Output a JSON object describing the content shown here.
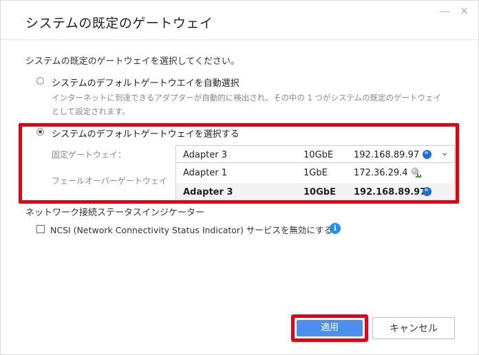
{
  "dialog": {
    "title": "システムの既定のゲートウェイ",
    "window_controls": {
      "minimize": "—",
      "close": "✕"
    },
    "prompt": "システムの既定のゲートウェイを選択してください。",
    "option_auto": {
      "label": "システムのデフォルトゲートウエイを自動選択",
      "description": "インターネットに到達できるアダプターが自動的に検出され、その中の 1 つがシステムの既定のゲートウェイとして設定されます。",
      "selected": false
    },
    "option_manual": {
      "label": "システムのデフォルトゲートウェイを選択する",
      "selected": true,
      "fixed_gateway_label": "固定ゲートウェイ：",
      "failover_gateway_label": "フェールオーバーゲートウェイ",
      "selected_adapter": {
        "name": "Adapter 3",
        "speed": "10GbE",
        "ip": "192.168.89.97",
        "icon": "globe-icon"
      },
      "adapters": [
        {
          "name": "Adapter 1",
          "speed": "1GbE",
          "ip": "172.36.29.4",
          "icon": "network-icon"
        },
        {
          "name": "Adapter 3",
          "speed": "10GbE",
          "ip": "192.168.89.97",
          "icon": "globe-icon"
        }
      ]
    },
    "ncsi_section": {
      "title": "ネットワーク接続ステータスインジケーター",
      "checkbox_label": "NCSI (Network Connectivity Status Indicator) サービスを無効にする",
      "checked": false,
      "info_icon": "i"
    },
    "buttons": {
      "apply": "適用",
      "cancel": "キャンセル"
    },
    "colors": {
      "accent": "#4a90f0",
      "highlight": "#e60012",
      "info": "#1e90ff"
    }
  }
}
